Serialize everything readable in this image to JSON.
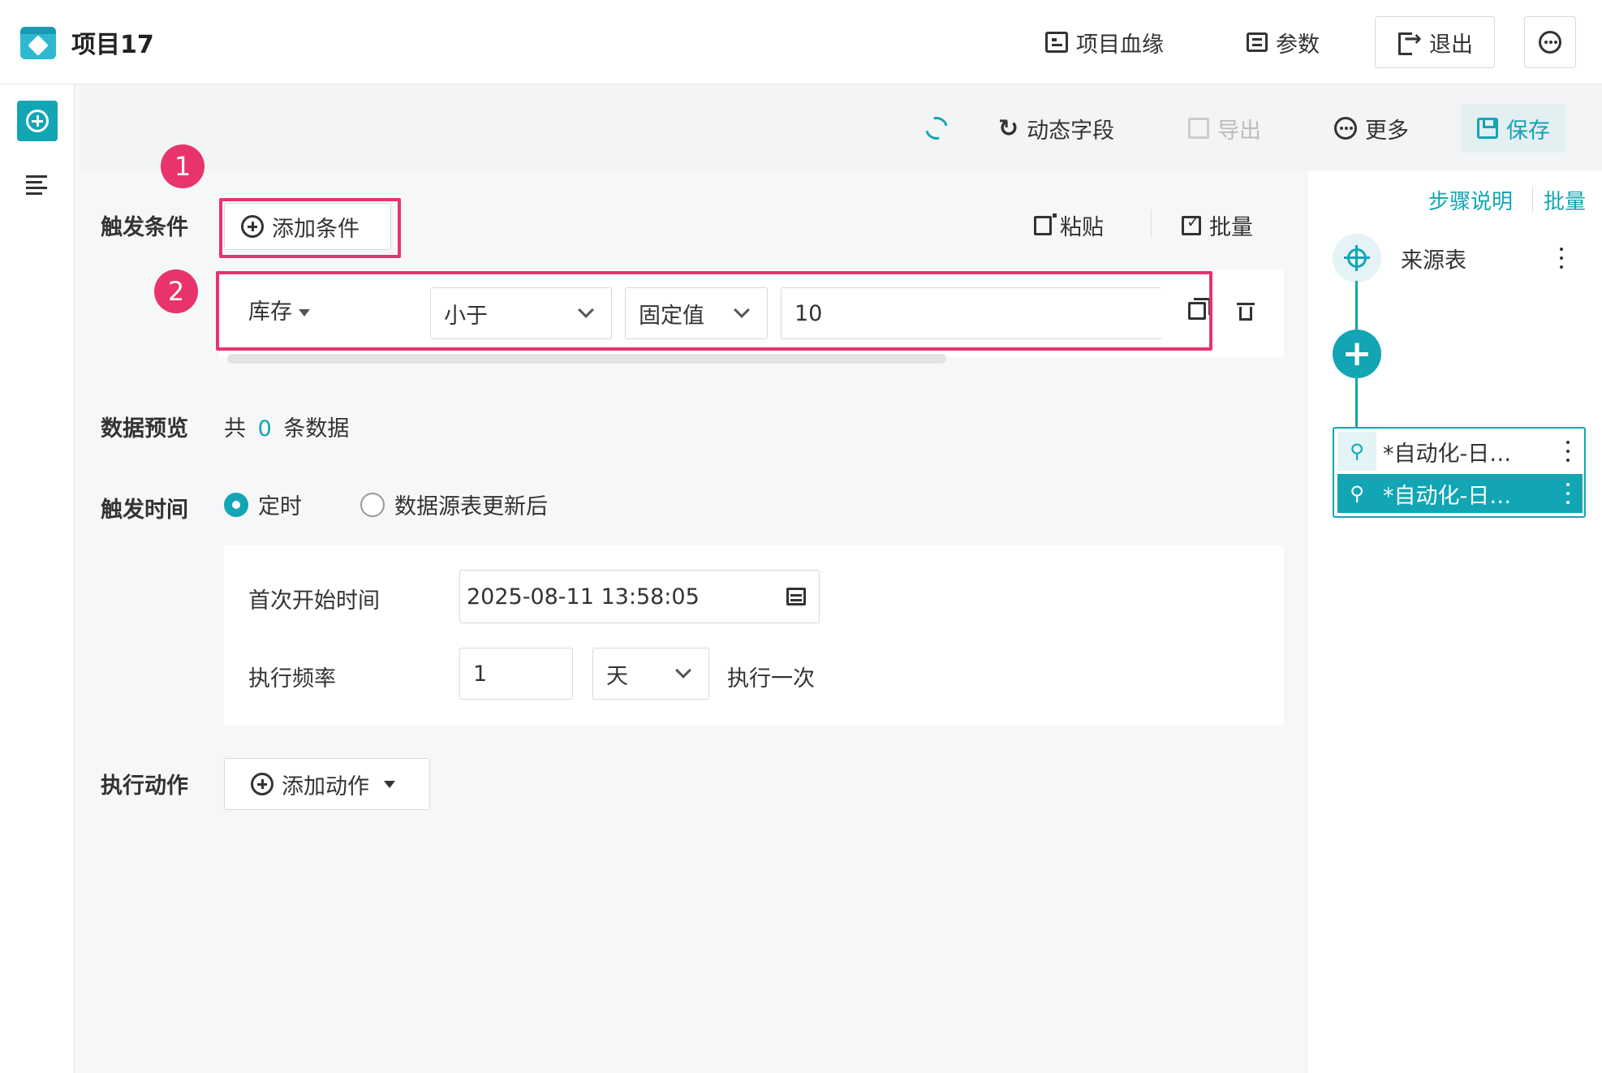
{
  "header": {
    "title": "项目17",
    "lineage_label": "项目血缘",
    "params_label": "参数",
    "exit_label": "退出"
  },
  "toolbar": {
    "dynamic_field_label": "动态字段",
    "export_label": "导出",
    "more_label": "更多",
    "save_label": "保存"
  },
  "form": {
    "trigger_condition_label": "触发条件",
    "add_condition_label": "添加条件",
    "paste_label": "粘贴",
    "batch_label": "批量",
    "badges": [
      "1",
      "2"
    ],
    "condition": {
      "field": "库存",
      "operator": "小于",
      "value_type": "固定值",
      "value": "10"
    },
    "data_preview_label": "数据预览",
    "preview_prefix": "共",
    "preview_count": "0",
    "preview_suffix": "条数据",
    "trigger_time_label": "触发时间",
    "radio_scheduled": "定时",
    "radio_after_update": "数据源表更新后",
    "first_start_label": "首次开始时间",
    "first_start_value": "2025-08-11 13:58:05",
    "frequency_label": "执行频率",
    "frequency_value": "1",
    "frequency_unit": "天",
    "frequency_suffix": "执行一次",
    "action_label": "执行动作",
    "add_action_label": "添加动作"
  },
  "right_panel": {
    "step_desc_label": "步骤说明",
    "batch_label": "批量",
    "source_node_label": "来源表",
    "steps": [
      {
        "label": "*自动化-日…",
        "selected": false
      },
      {
        "label": "*自动化-日…",
        "selected": true
      }
    ]
  },
  "colors": {
    "accent": "#12a5b4",
    "highlight": "#e8336d"
  }
}
